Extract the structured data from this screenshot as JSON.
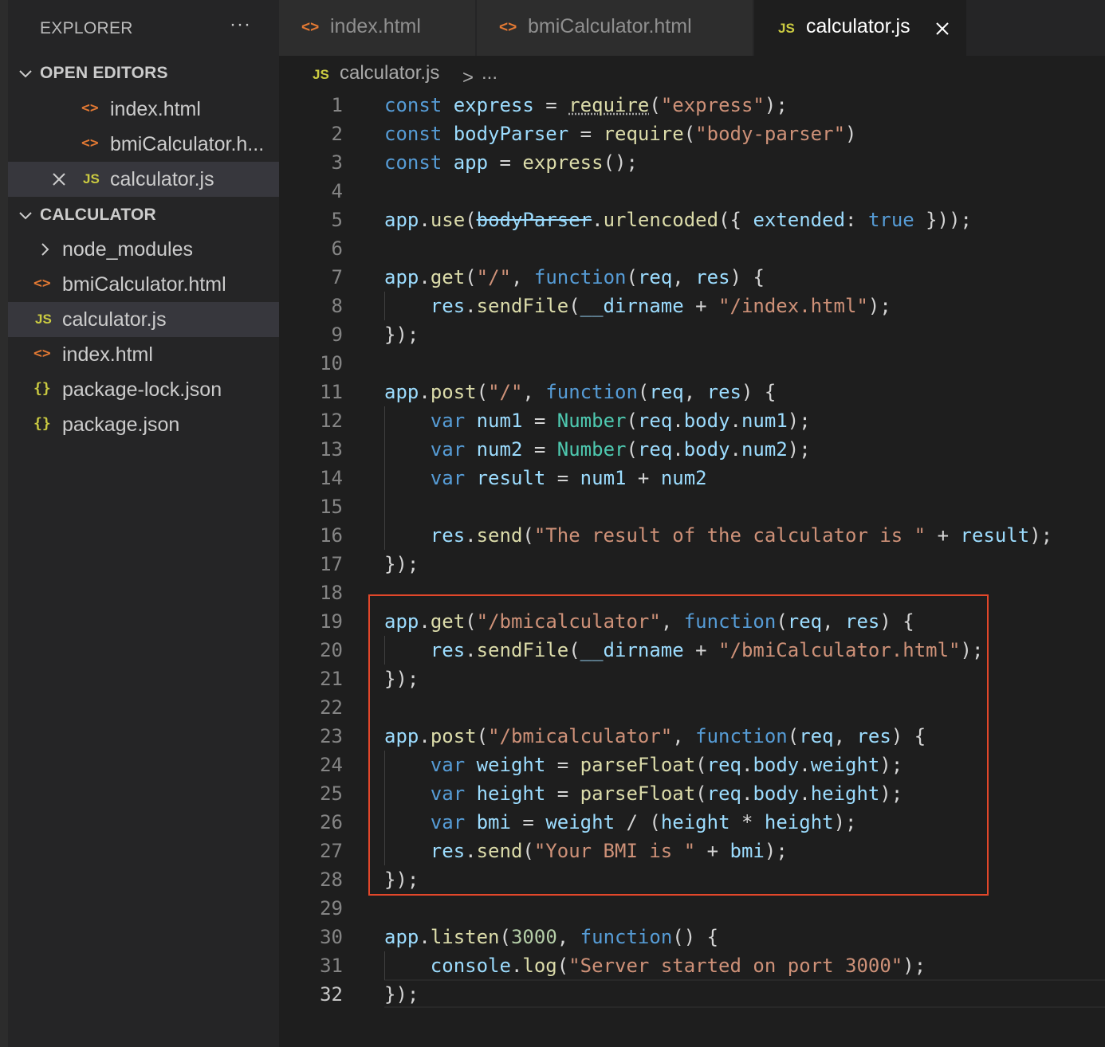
{
  "sidebar": {
    "title": "EXPLORER",
    "more": "···",
    "open_editors_label": "OPEN EDITORS",
    "open_editors": [
      {
        "label": "index.html",
        "icon": "<>"
      },
      {
        "label": "bmiCalculator.h...",
        "icon": "<>"
      },
      {
        "label": "calculator.js",
        "icon": "JS"
      }
    ],
    "folder_label": "CALCULATOR",
    "files": [
      {
        "label": "node_modules",
        "icon": "chevron-right-icon"
      },
      {
        "label": "bmiCalculator.html",
        "icon": "<>"
      },
      {
        "label": "calculator.js",
        "icon": "JS"
      },
      {
        "label": "index.html",
        "icon": "<>"
      },
      {
        "label": "package-lock.json",
        "icon": "{}"
      },
      {
        "label": "package.json",
        "icon": "{}"
      }
    ]
  },
  "tabs": [
    {
      "label": "index.html",
      "icon": "<>"
    },
    {
      "label": "bmiCalculator.html",
      "icon": "<>"
    },
    {
      "label": "calculator.js",
      "icon": "JS",
      "active": true
    }
  ],
  "breadcrumb": {
    "icon": "JS",
    "file": "calculator.js",
    "separator": ">",
    "more": "..."
  },
  "editor": {
    "current_line": 32,
    "lines": [
      "const express = require(\"express\");",
      "const bodyParser = require(\"body-parser\")",
      "const app = express();",
      "",
      "app.use(bodyParser.urlencoded({ extended: true }));",
      "",
      "app.get(\"/\", function(req, res) {",
      "    res.sendFile(__dirname + \"/index.html\");",
      "});",
      "",
      "app.post(\"/\", function(req, res) {",
      "    var num1 = Number(req.body.num1);",
      "    var num2 = Number(req.body.num2);",
      "    var result = num1 + num2",
      "",
      "    res.send(\"The result of the calculator is \" + result);",
      "});",
      "",
      "app.get(\"/bmicalculator\", function(req, res) {",
      "    res.sendFile(__dirname + \"/bmiCalculator.html\");",
      "});",
      "",
      "app.post(\"/bmicalculator\", function(req, res) {",
      "    var weight = parseFloat(req.body.weight);",
      "    var height = parseFloat(req.body.height);",
      "    var bmi = weight / (height * height);",
      "    res.send(\"Your BMI is \" + bmi);",
      "});",
      "",
      "app.listen(3000, function() {",
      "    console.log(\"Server started on port 3000\");",
      "});"
    ]
  },
  "colors": {
    "keyword": "#569cd6",
    "variable": "#9cdcfe",
    "function": "#dcdcaa",
    "string": "#ce9178",
    "number": "#b5cea8",
    "class": "#4ec9b0",
    "highlight_box": "#e2472a"
  }
}
